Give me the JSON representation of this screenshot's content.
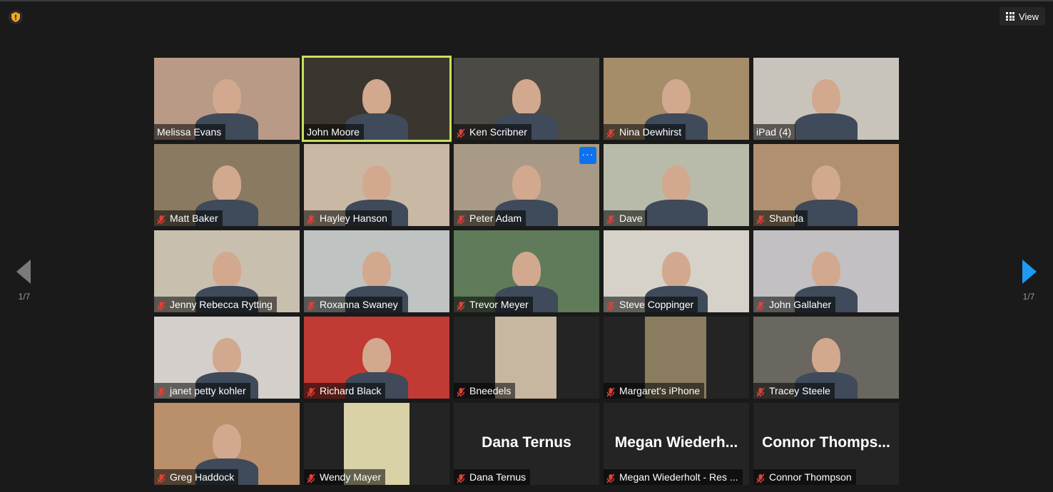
{
  "toolbar": {
    "view_label": "View"
  },
  "nav": {
    "left_page": "1/7",
    "right_page": "1/7"
  },
  "colors": {
    "active_speaker": "#c8e05a",
    "accent": "#0e72ed",
    "muted_icon": "#e0403a"
  },
  "participants": [
    {
      "name": "Melissa Evans",
      "muted": false,
      "bg": "#b89a86"
    },
    {
      "name": "John Moore",
      "muted": false,
      "bg": "#3b3530",
      "active": true
    },
    {
      "name": "Ken Scribner",
      "muted": true,
      "bg": "#4b4a45"
    },
    {
      "name": "Nina Dewhirst",
      "muted": true,
      "bg": "#a58d6a"
    },
    {
      "name": "iPad (4)",
      "muted": false,
      "bg": "#c9c4bb"
    },
    {
      "name": "Matt Baker",
      "muted": true,
      "bg": "#8a7a62"
    },
    {
      "name": "Hayley Hanson",
      "muted": true,
      "bg": "#c9b8a4"
    },
    {
      "name": "Peter Adam",
      "muted": true,
      "bg": "#a89a86"
    },
    {
      "name": "Dave",
      "muted": true,
      "bg": "#b8bba9"
    },
    {
      "name": "Shanda",
      "muted": true,
      "bg": "#b09070"
    },
    {
      "name": "Jenny Rebecca Rytting",
      "muted": true,
      "bg": "#c9bfae"
    },
    {
      "name": "Roxanna Swaney",
      "muted": true,
      "bg": "#bfc3c2"
    },
    {
      "name": "Trevor Meyer",
      "muted": true,
      "bg": "#5f7b5a"
    },
    {
      "name": "Steve Coppinger",
      "muted": true,
      "bg": "#d6d2c9"
    },
    {
      "name": "John Gallaher",
      "muted": true,
      "bg": "#c2c0c3"
    },
    {
      "name": "janet petty kohler",
      "muted": true,
      "bg": "#d4cfca"
    },
    {
      "name": "Richard Black",
      "muted": true,
      "bg": "#c23a34"
    },
    {
      "name": "Bneedels",
      "muted": true,
      "bg": "#242424"
    },
    {
      "name": "Margaret's iPhone",
      "muted": true,
      "bg": "#242424"
    },
    {
      "name": "Tracey Steele",
      "muted": true,
      "bg": "#6a6660"
    },
    {
      "name": "Greg Haddock",
      "muted": true,
      "bg": "#b98f6c"
    },
    {
      "name": "Wendy Mayer",
      "muted": true,
      "bg": "#242424"
    },
    {
      "name": "Dana Ternus",
      "muted": true,
      "bg": "#242424",
      "display": "Dana Ternus"
    },
    {
      "name": "Megan Wiederholt - Res ...",
      "muted": true,
      "bg": "#242424",
      "display": "Megan  Wiederh..."
    },
    {
      "name": "Connor Thompson",
      "muted": true,
      "bg": "#242424",
      "display": "Connor  Thomps..."
    }
  ]
}
